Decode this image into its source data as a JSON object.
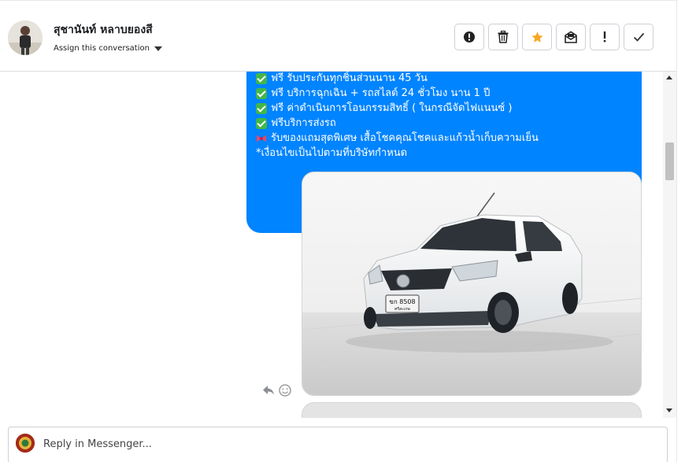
{
  "header": {
    "contact_name": "สุชานันท์ หลาบยองสี",
    "assign_label": "Assign this conversation",
    "actions": [
      {
        "name": "report-spam-button",
        "icon": "alert-circle-icon"
      },
      {
        "name": "delete-button",
        "icon": "trash-icon"
      },
      {
        "name": "star-button",
        "icon": "star-icon",
        "color": "#f5a623"
      },
      {
        "name": "mark-unread-button",
        "icon": "envelope-icon"
      },
      {
        "name": "follow-up-button",
        "icon": "exclamation-icon"
      },
      {
        "name": "mark-done-button",
        "icon": "check-icon"
      }
    ]
  },
  "message": {
    "lines": [
      {
        "icon": "check-box-icon",
        "text": "ฟรี รับประกันทุกชิ้นส่วนนาน 45 วัน"
      },
      {
        "icon": "check-box-icon",
        "text": "ฟรี บริการฉุกเฉิน + รถสไลด์ 24 ชั่วโมง นาน 1 ปี"
      },
      {
        "icon": "check-box-icon",
        "text": "ฟรี ค่าดำเนินการโอนกรรมสิทธิ์ ( ในกรณีจัดไฟแนนซ์ )"
      },
      {
        "icon": "check-box-icon",
        "text": "ฟรีบริการส่งรถ"
      },
      {
        "icon": "ribbon-icon",
        "text": "รับของแถมสุดพิเศษ เสื้อโชคคุณโชคและแก้วน้ำเก็บความเย็น"
      },
      {
        "icon": "",
        "text": "*เงื่อนไขเป็นไปตามที่บริษัทกำหนด"
      }
    ],
    "bubble_color": "#0084ff"
  },
  "photo": {
    "plate_line1": "ขก 8508",
    "plate_line2": "ศรีสะเกษ"
  },
  "composer": {
    "placeholder": "Reply in Messenger..."
  }
}
